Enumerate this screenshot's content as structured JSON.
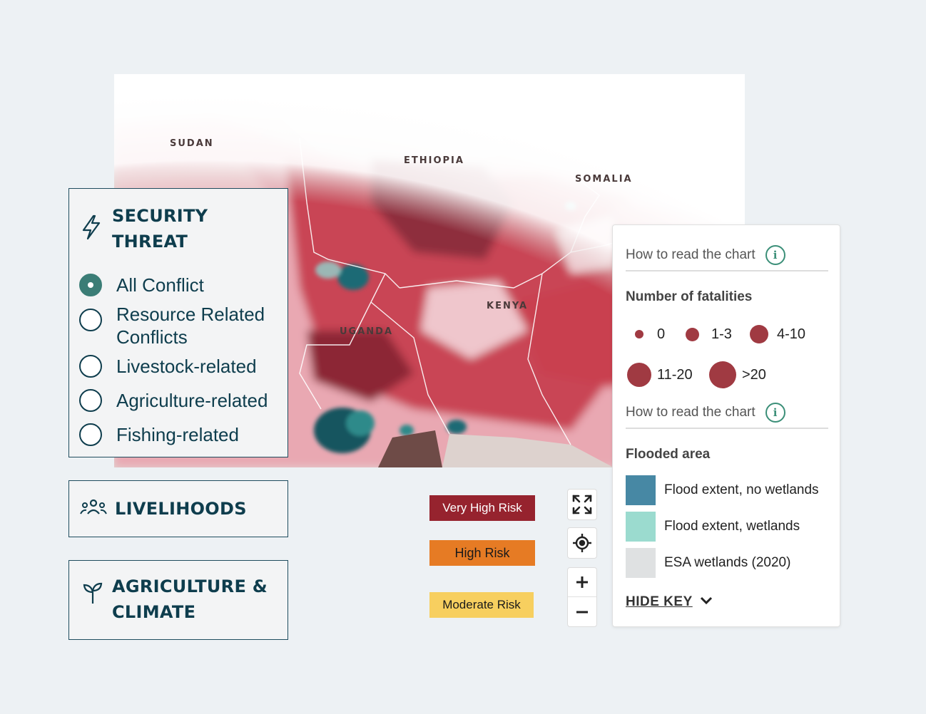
{
  "map": {
    "labels": [
      {
        "id": "sudan",
        "text": "SUDAN"
      },
      {
        "id": "ethiopia",
        "text": "ETHIOPIA"
      },
      {
        "id": "somalia",
        "text": "SOMALIA"
      },
      {
        "id": "kenya",
        "text": "KENYA"
      },
      {
        "id": "uganda",
        "text": "UGANDA"
      }
    ]
  },
  "security_panel": {
    "title": "SECURITY THREAT",
    "icon": "lightning-icon",
    "options": [
      {
        "label": "All Conflict",
        "checked": true
      },
      {
        "label": "Resource Related Conflicts",
        "checked": false
      },
      {
        "label": "Livestock-related",
        "checked": false
      },
      {
        "label": "Agriculture-related",
        "checked": false
      },
      {
        "label": "Fishing-related",
        "checked": false
      }
    ]
  },
  "livelihoods_panel": {
    "title": "LIVELIHOODS",
    "icon": "people-icon"
  },
  "agriculture_panel": {
    "title": "AGRICULTURE & CLIMATE",
    "icon": "sprout-icon"
  },
  "risk_levels": [
    {
      "label": "Very High Risk",
      "color": "#96232e"
    },
    {
      "label": "High Risk",
      "color": "#e67b24"
    },
    {
      "label": "Moderate Risk",
      "color": "#f7cf5f"
    }
  ],
  "map_controls": [
    "fullscreen-icon",
    "locate-icon",
    "zoom-in-icon",
    "zoom-out-icon"
  ],
  "legend": {
    "how_to_read_1": "How to read the chart",
    "fatalities_title": "Number of fatalities",
    "fatalities": [
      {
        "label": "0"
      },
      {
        "label": "1-3"
      },
      {
        "label": "4-10"
      },
      {
        "label": "11-20"
      },
      {
        "label": ">20"
      }
    ],
    "bubble_color": "#a03a42",
    "how_to_read_2": "How to read the chart",
    "flood_title": "Flooded area",
    "flood_items": [
      {
        "label": "Flood extent, no wetlands",
        "color": "#4788a4"
      },
      {
        "label": "Flood extent, wetlands",
        "color": "#9bdbcf"
      },
      {
        "label": "ESA wetlands (2020)",
        "color": "#dfe1e2"
      }
    ],
    "hide_key": "HIDE KEY"
  }
}
